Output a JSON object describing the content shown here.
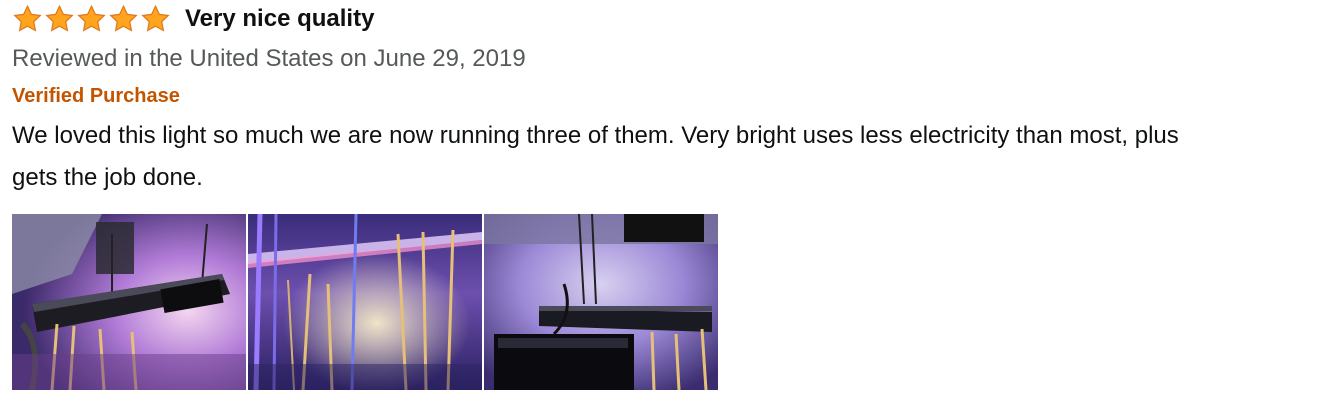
{
  "review": {
    "rating": 5,
    "rating_max": 5,
    "star_color": "#ffa41c",
    "title": "Very nice quality",
    "date": "Reviewed in the United States on June 29, 2019",
    "verified_label": "Verified Purchase",
    "verified_color": "#c45500",
    "body_line_1": "We loved this light so much we are now running three of them. Very bright uses less electricity than most, plus",
    "body_line_2": "gets the job done",
    "body_end": ".",
    "highlight_color": "#9ef19e",
    "images": [
      {
        "name": "grow-light-photo-1"
      },
      {
        "name": "grow-light-photo-2"
      },
      {
        "name": "grow-light-photo-3"
      }
    ]
  }
}
